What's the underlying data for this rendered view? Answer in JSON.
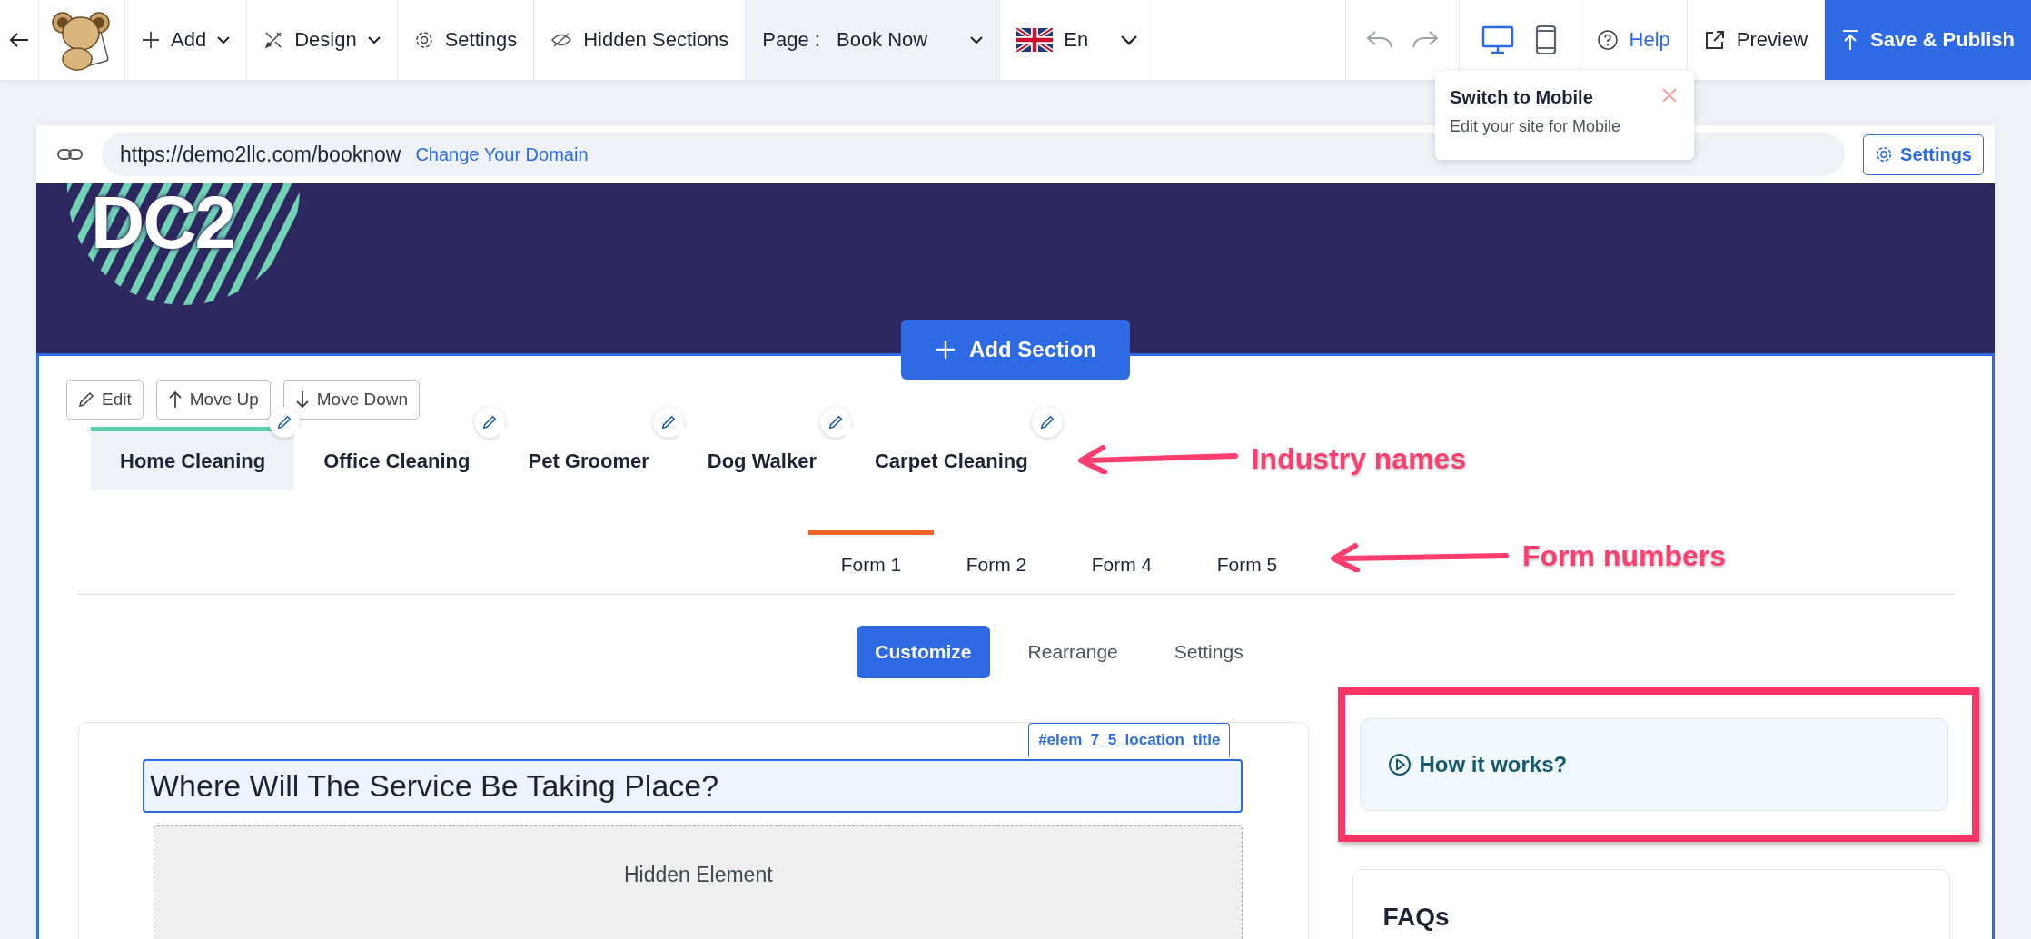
{
  "toolbar": {
    "add": "Add",
    "design": "Design",
    "settings": "Settings",
    "hidden_sections": "Hidden Sections",
    "page_label": "Page :",
    "page_value": "Book Now",
    "language": "En",
    "devices": [
      {
        "kind": "desktop",
        "selected": true
      },
      {
        "kind": "mobile",
        "selected": false
      }
    ],
    "help": "Help",
    "preview": "Preview",
    "save": "Save & Publish"
  },
  "tooltip": {
    "title": "Switch to Mobile",
    "text": "Edit your site for Mobile"
  },
  "url_bar": {
    "url": "https://demo2llc.com/booknow",
    "change_domain": "Change Your Domain",
    "settings": "Settings"
  },
  "banner": {
    "logo_text": "DC2"
  },
  "add_section": "Add Section",
  "section_actions": [
    {
      "kind": "edit",
      "label": "Edit"
    },
    {
      "kind": "up",
      "label": "Move Up"
    },
    {
      "kind": "down",
      "label": "Move Down"
    }
  ],
  "industries": [
    {
      "label": "Home Cleaning",
      "selected": true
    },
    {
      "label": "Office Cleaning",
      "selected": false
    },
    {
      "label": "Pet Groomer",
      "selected": false
    },
    {
      "label": "Dog Walker",
      "selected": false
    },
    {
      "label": "Carpet Cleaning",
      "selected": false
    }
  ],
  "forms": [
    {
      "label": "Form 1",
      "selected": true
    },
    {
      "label": "Form 2",
      "selected": false
    },
    {
      "label": "Form 4",
      "selected": false
    },
    {
      "label": "Form 5",
      "selected": false
    }
  ],
  "mode_tabs": [
    {
      "label": "Customize",
      "selected": true
    },
    {
      "label": "Rearrange",
      "selected": false
    },
    {
      "label": "Settings",
      "selected": false
    }
  ],
  "form_card": {
    "element_id": "#elem_7_5_location_title",
    "title": "Where Will The Service Be Taking Place?",
    "hidden_label": "Hidden Element"
  },
  "side_cards": {
    "how_it_works": "How it works?",
    "faqs": "FAQs"
  },
  "annotations": [
    {
      "kind": "industries",
      "text": "Industry names"
    },
    {
      "kind": "forms",
      "text": "Form numbers"
    }
  ]
}
